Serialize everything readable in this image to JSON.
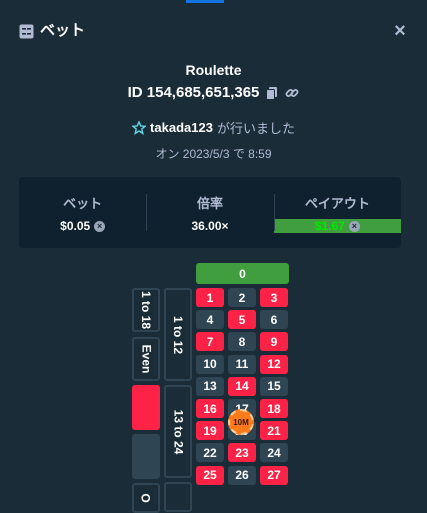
{
  "header": {
    "title": "ベット",
    "icon": "bet-slip-icon",
    "close_icon": "close-icon",
    "close_label": "×"
  },
  "game": {
    "name": "Roulette",
    "bet_id": "ID 154,685,651,365"
  },
  "user": {
    "name": "takada123",
    "suffix": "が行いました",
    "icon": "star-icon"
  },
  "datetime": "オン 2023/5/3 で 8:59",
  "stats": [
    {
      "label": "ベット",
      "value": "$0.05",
      "color": "#ffffff"
    },
    {
      "label": "倍率",
      "value": "36.00×",
      "color": "#ffffff"
    },
    {
      "label": "ペイアウト",
      "value": "$1.67",
      "color": "#00e701"
    }
  ],
  "board": {
    "zero": "0",
    "rows": [
      [
        {
          "n": "1",
          "c": "red"
        },
        {
          "n": "2",
          "c": "black"
        },
        {
          "n": "3",
          "c": "red"
        }
      ],
      [
        {
          "n": "4",
          "c": "black"
        },
        {
          "n": "5",
          "c": "red"
        },
        {
          "n": "6",
          "c": "black"
        }
      ],
      [
        {
          "n": "7",
          "c": "red"
        },
        {
          "n": "8",
          "c": "black"
        },
        {
          "n": "9",
          "c": "red"
        }
      ],
      [
        {
          "n": "10",
          "c": "black"
        },
        {
          "n": "11",
          "c": "black"
        },
        {
          "n": "12",
          "c": "red"
        }
      ],
      [
        {
          "n": "13",
          "c": "black"
        },
        {
          "n": "14",
          "c": "red"
        },
        {
          "n": "15",
          "c": "black"
        }
      ],
      [
        {
          "n": "16",
          "c": "red"
        },
        {
          "n": "17",
          "c": "black"
        },
        {
          "n": "18",
          "c": "red"
        }
      ],
      [
        {
          "n": "19",
          "c": "red"
        },
        {
          "n": "20",
          "c": "black"
        },
        {
          "n": "21",
          "c": "red"
        }
      ],
      [
        {
          "n": "22",
          "c": "black"
        },
        {
          "n": "23",
          "c": "red"
        },
        {
          "n": "24",
          "c": "black"
        }
      ],
      [
        {
          "n": "25",
          "c": "red"
        },
        {
          "n": "26",
          "c": "black"
        },
        {
          "n": "27",
          "c": "red"
        }
      ]
    ],
    "dozens": [
      "1 to 12",
      "13 to 24"
    ],
    "outside_labels": [
      "1 to 18",
      "Even",
      "",
      "",
      "O"
    ],
    "chip": {
      "label": "10M",
      "on_number": "17"
    },
    "colors": {
      "red": "#fe2247",
      "black": "#2f4553",
      "green": "#419e3f"
    }
  }
}
